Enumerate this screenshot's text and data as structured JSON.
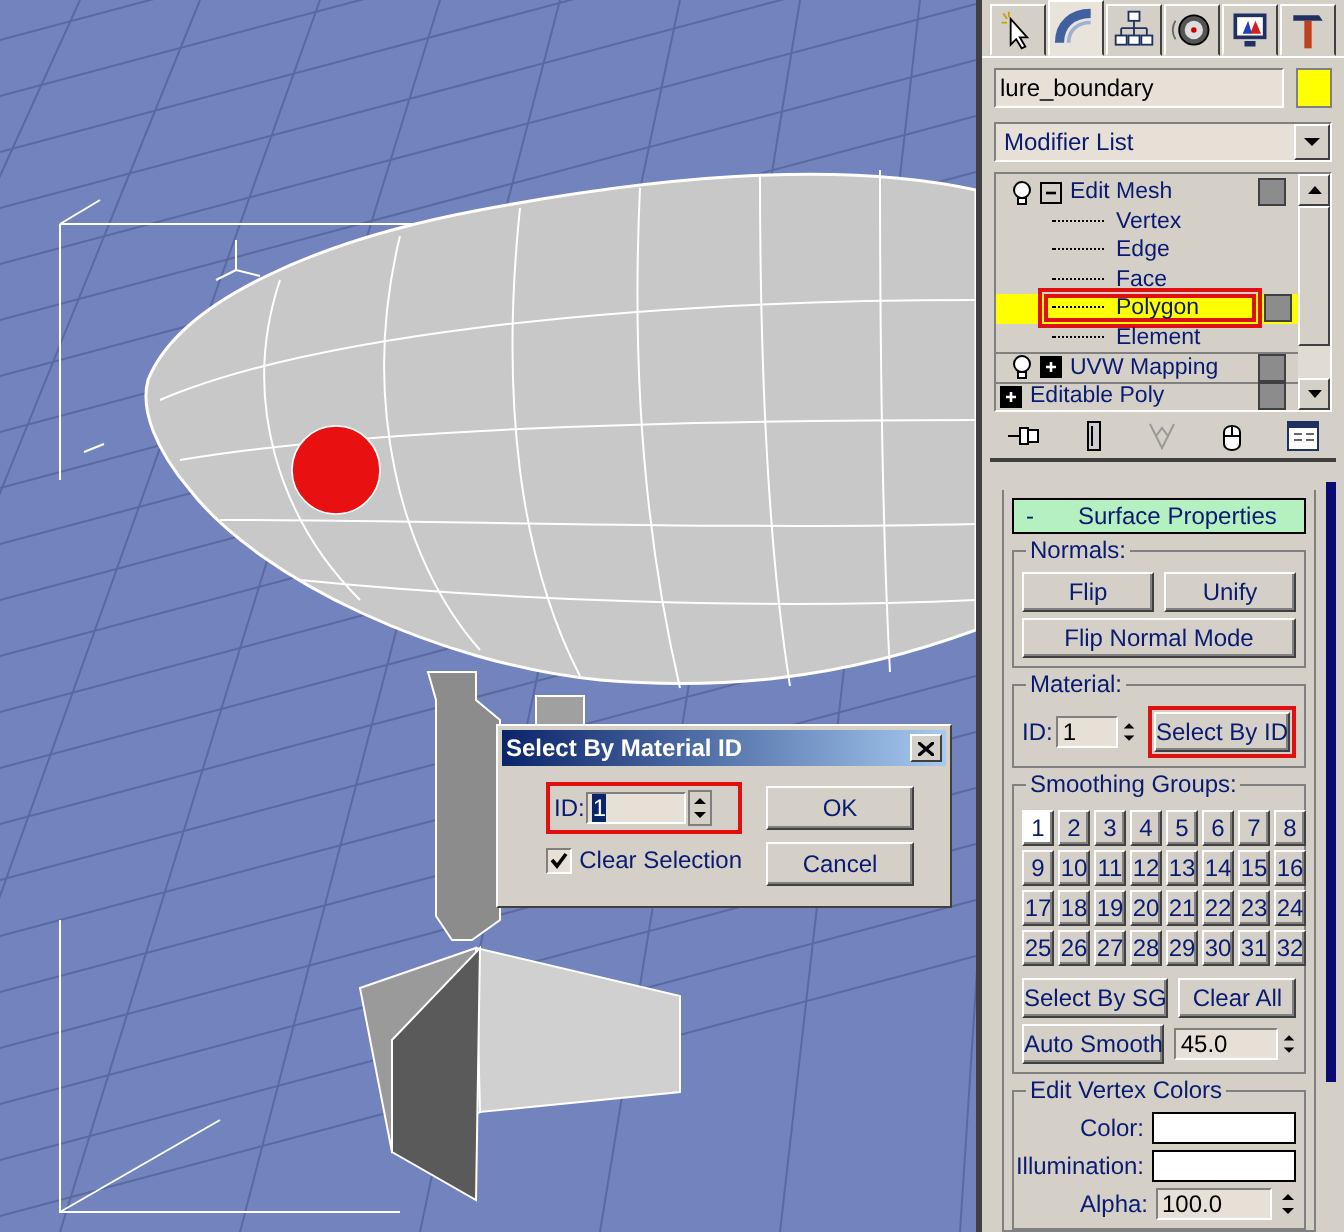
{
  "viewport": {
    "dialog": {
      "title": "Select By Material ID",
      "id_label": "ID:",
      "id_value": "1",
      "id_highlighted": true,
      "clear_selection": {
        "label": "Clear Selection",
        "checked": true
      },
      "buttons": [
        "OK",
        "Cancel"
      ]
    }
  },
  "panel": {
    "tabs": [
      {
        "kind": "create",
        "selected": false
      },
      {
        "kind": "modify",
        "selected": true
      },
      {
        "kind": "hierarchy",
        "selected": false
      },
      {
        "kind": "motion",
        "selected": false
      },
      {
        "kind": "display",
        "selected": false
      },
      {
        "kind": "utilities",
        "selected": false
      }
    ],
    "object_name": "lure_boundary",
    "modifier_list": "Modifier List",
    "stack": [
      {
        "label": "Edit Mesh",
        "kind": "modifier",
        "expanded": true,
        "children": [
          {
            "label": "Vertex",
            "selected": false,
            "highlighted": false
          },
          {
            "label": "Edge",
            "selected": false,
            "highlighted": false
          },
          {
            "label": "Face",
            "selected": false,
            "highlighted": false
          },
          {
            "label": "Polygon",
            "selected": true,
            "highlighted": true
          },
          {
            "label": "Element",
            "selected": false,
            "highlighted": false
          }
        ]
      },
      {
        "label": "UVW Mapping",
        "kind": "modifier",
        "expanded": false
      },
      {
        "label": "Editable Poly",
        "kind": "base",
        "expanded": false
      }
    ],
    "rollout": {
      "collapse": "-",
      "title": "Surface Properties",
      "normals": {
        "label": "Normals:",
        "buttons": [
          "Flip",
          "Unify"
        ],
        "wide_button": "Flip Normal Mode"
      },
      "material": {
        "label": "Material:",
        "id_label": "ID:",
        "id_value": "1",
        "button": "Select By ID",
        "button_highlighted": true
      },
      "smoothing": {
        "label": "Smoothing Groups:",
        "groups": [
          {
            "label": "1",
            "on": true
          },
          {
            "label": "2",
            "on": false
          },
          {
            "label": "3",
            "on": false
          },
          {
            "label": "4",
            "on": false
          },
          {
            "label": "5",
            "on": false
          },
          {
            "label": "6",
            "on": false
          },
          {
            "label": "7",
            "on": false
          },
          {
            "label": "8",
            "on": false
          },
          {
            "label": "9",
            "on": false
          },
          {
            "label": "10",
            "on": false
          },
          {
            "label": "11",
            "on": false
          },
          {
            "label": "12",
            "on": false
          },
          {
            "label": "13",
            "on": false
          },
          {
            "label": "14",
            "on": false
          },
          {
            "label": "15",
            "on": false
          },
          {
            "label": "16",
            "on": false
          },
          {
            "label": "17",
            "on": false
          },
          {
            "label": "18",
            "on": false
          },
          {
            "label": "19",
            "on": false
          },
          {
            "label": "20",
            "on": false
          },
          {
            "label": "21",
            "on": false
          },
          {
            "label": "22",
            "on": false
          },
          {
            "label": "23",
            "on": false
          },
          {
            "label": "24",
            "on": false
          },
          {
            "label": "25",
            "on": false
          },
          {
            "label": "26",
            "on": false
          },
          {
            "label": "27",
            "on": false
          },
          {
            "label": "28",
            "on": false
          },
          {
            "label": "29",
            "on": false
          },
          {
            "label": "30",
            "on": false
          },
          {
            "label": "31",
            "on": false
          },
          {
            "label": "32",
            "on": false
          }
        ],
        "buttons": [
          "Select By SG",
          "Clear All"
        ],
        "auto_smooth": "Auto Smooth",
        "threshold": "45.0"
      },
      "vertex_colors": {
        "label": "Edit Vertex Colors",
        "color_label": "Color:",
        "illumination_label": "Illumination:",
        "alpha_label": "Alpha:",
        "alpha": "100.0"
      }
    }
  }
}
